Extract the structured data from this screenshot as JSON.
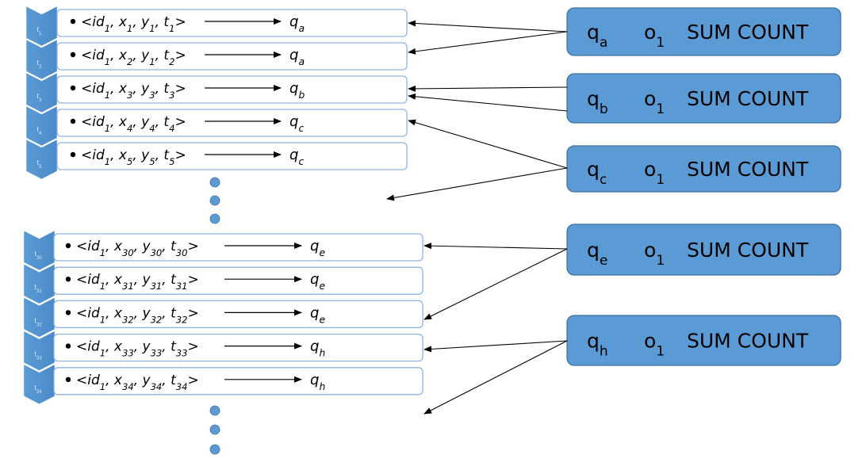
{
  "colors": {
    "accent": "#5b9bd5",
    "accent_border": "#41719c",
    "row_border": "#8fb4e3",
    "dot": "#5b9bd5"
  },
  "groups": [
    {
      "rows": [
        {
          "t": "1",
          "id": "1",
          "x": "1",
          "y": "1",
          "ts": "1",
          "q": "a"
        },
        {
          "t": "2",
          "id": "1",
          "x": "2",
          "y": "1",
          "ts": "2",
          "q": "a"
        },
        {
          "t": "3",
          "id": "1",
          "x": "3",
          "y": "3",
          "ts": "3",
          "q": "b"
        },
        {
          "t": "4",
          "id": "1",
          "x": "4",
          "y": "4",
          "ts": "4",
          "q": "c"
        },
        {
          "t": "5",
          "id": "1",
          "x": "5",
          "y": "5",
          "ts": "5",
          "q": "c"
        }
      ]
    },
    {
      "rows": [
        {
          "t": "30",
          "id": "1",
          "x": "30",
          "y": "30",
          "ts": "30",
          "q": "e"
        },
        {
          "t": "31",
          "id": "1",
          "x": "31",
          "y": "31",
          "ts": "31",
          "q": "e"
        },
        {
          "t": "32",
          "id": "1",
          "x": "32",
          "y": "32",
          "ts": "32",
          "q": "e"
        },
        {
          "t": "33",
          "id": "1",
          "x": "33",
          "y": "33",
          "ts": "33",
          "q": "h"
        },
        {
          "t": "34",
          "id": "1",
          "x": "34",
          "y": "34",
          "ts": "34",
          "q": "h"
        }
      ]
    }
  ],
  "query_boxes": [
    {
      "q": "a",
      "o": "1",
      "aggregates": "SUM COUNT"
    },
    {
      "q": "b",
      "o": "1",
      "aggregates": "SUM COUNT"
    },
    {
      "q": "c",
      "o": "1",
      "aggregates": "SUM COUNT"
    },
    {
      "q": "e",
      "o": "1",
      "aggregates": "SUM COUNT"
    },
    {
      "q": "h",
      "o": "1",
      "aggregates": "SUM COUNT"
    }
  ]
}
